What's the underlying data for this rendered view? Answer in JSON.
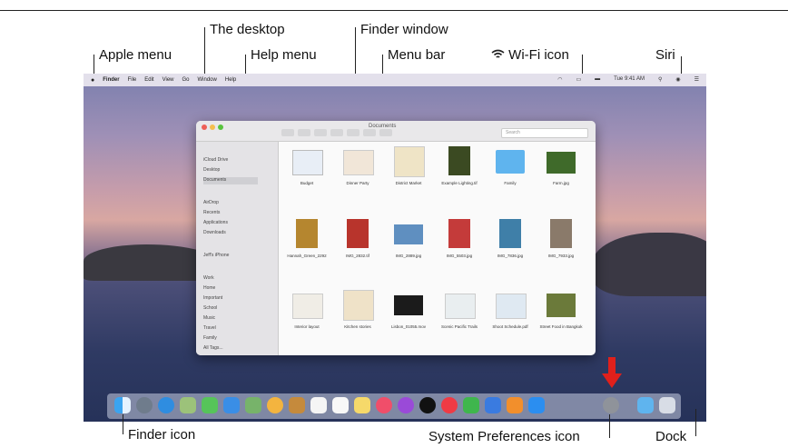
{
  "callouts": {
    "apple_menu": "Apple menu",
    "the_desktop": "The desktop",
    "help_menu": "Help menu",
    "finder_window": "Finder window",
    "menu_bar": "Menu bar",
    "wifi_icon": "Wi-Fi icon",
    "siri": "Siri",
    "finder_icon": "Finder icon",
    "system_preferences_icon": "System Preferences icon",
    "dock": "Dock"
  },
  "menubar": {
    "items": [
      "Finder",
      "File",
      "Edit",
      "View",
      "Go",
      "Window",
      "Help"
    ],
    "clock": "Tue 9:41 AM"
  },
  "finder": {
    "title": "Documents",
    "search_placeholder": "Search",
    "sidebar": [
      "iCloud Drive",
      "Desktop",
      "Documents",
      "AirDrop",
      "Recents",
      "Applications",
      "Downloads",
      "Jeff's iPhone",
      "Work",
      "Home",
      "Important",
      "School",
      "Music",
      "Travel",
      "Family",
      "All Tags..."
    ],
    "files": [
      "Budget",
      "Dinner Party",
      "District Market",
      "Example Lighting.tif",
      "Family",
      "Farm.jpg",
      "Hannah_Green_2292",
      "IMG_2832.tif",
      "IMG_2889.jpg",
      "IMG_5503.jpg",
      "IMG_7836.jpg",
      "IMG_7933.jpg",
      "Interior layout",
      "Kitchen stories",
      "Lisbon_01055.mov",
      "Scenic Pacific Trails",
      "Shoot Schedule.pdf",
      "Street Food in Bangkok"
    ]
  },
  "colors": {
    "dock_arrow": "#e0201b",
    "folder_blue": "#5fb4ee"
  }
}
